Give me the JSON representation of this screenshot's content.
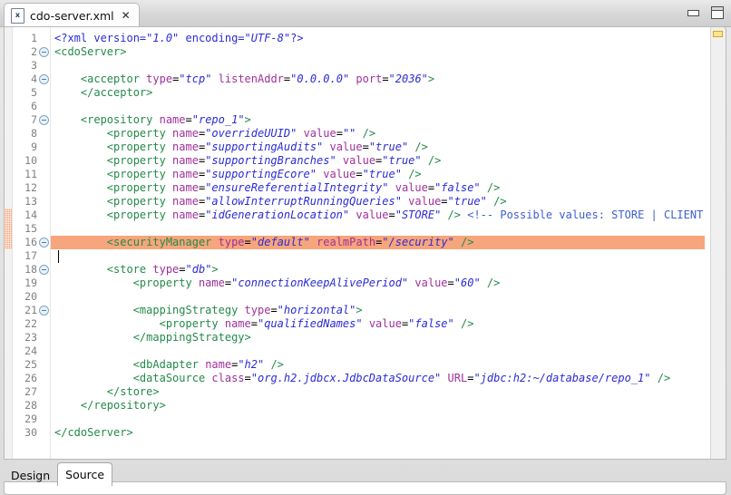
{
  "window": {
    "tab_title": "cdo-server.xml",
    "file_icon": "xml-file-icon",
    "close_icon": "✕",
    "minimize_label": "",
    "maximize_label": ""
  },
  "editor": {
    "highlighted_line": 16,
    "caret_line": 17,
    "change_bar_lines": [
      14,
      15,
      16
    ],
    "fold_lines": [
      2,
      4,
      7,
      16,
      18,
      21
    ],
    "overview_marker": "warning-marker",
    "colors": {
      "tag": "#248a49",
      "attribute": "#a0309a",
      "value": "#2b2bd4",
      "comment": "#3f5fd0",
      "highlight_row": "#f7a57c",
      "change_bar": "#f7a278",
      "warning_marker": "#ffe48a"
    },
    "lines": [
      {
        "n": 1,
        "fold": false,
        "chg": false,
        "hl": false,
        "tokens": [
          {
            "t": "decl",
            "s": "<?xml version="
          },
          {
            "t": "val",
            "s": "\"1.0\""
          },
          {
            "t": "decl",
            "s": " encoding="
          },
          {
            "t": "val",
            "s": "\"UTF-8\""
          },
          {
            "t": "decl",
            "s": "?>"
          }
        ]
      },
      {
        "n": 2,
        "fold": true,
        "chg": false,
        "hl": false,
        "tokens": [
          {
            "t": "tag",
            "s": "<cdoServer>"
          }
        ]
      },
      {
        "n": 3,
        "fold": false,
        "chg": false,
        "hl": false,
        "tokens": []
      },
      {
        "n": 4,
        "fold": true,
        "chg": false,
        "hl": false,
        "tokens": [
          {
            "t": "plain",
            "s": "    "
          },
          {
            "t": "tag",
            "s": "<acceptor "
          },
          {
            "t": "attr",
            "s": "type"
          },
          {
            "t": "eq",
            "s": "="
          },
          {
            "t": "val",
            "s": "\"tcp\""
          },
          {
            "t": "plain",
            "s": " "
          },
          {
            "t": "attr",
            "s": "listenAddr"
          },
          {
            "t": "eq",
            "s": "="
          },
          {
            "t": "val",
            "s": "\"0.0.0.0\""
          },
          {
            "t": "plain",
            "s": " "
          },
          {
            "t": "attr",
            "s": "port"
          },
          {
            "t": "eq",
            "s": "="
          },
          {
            "t": "val",
            "s": "\"2036\""
          },
          {
            "t": "tag",
            "s": ">"
          }
        ]
      },
      {
        "n": 5,
        "fold": false,
        "chg": false,
        "hl": false,
        "tokens": [
          {
            "t": "plain",
            "s": "    "
          },
          {
            "t": "tag",
            "s": "</acceptor>"
          }
        ]
      },
      {
        "n": 6,
        "fold": false,
        "chg": false,
        "hl": false,
        "tokens": []
      },
      {
        "n": 7,
        "fold": true,
        "chg": false,
        "hl": false,
        "tokens": [
          {
            "t": "plain",
            "s": "    "
          },
          {
            "t": "tag",
            "s": "<repository "
          },
          {
            "t": "attr",
            "s": "name"
          },
          {
            "t": "eq",
            "s": "="
          },
          {
            "t": "val",
            "s": "\"repo_1\""
          },
          {
            "t": "tag",
            "s": ">"
          }
        ]
      },
      {
        "n": 8,
        "fold": false,
        "chg": false,
        "hl": false,
        "tokens": [
          {
            "t": "plain",
            "s": "        "
          },
          {
            "t": "tag",
            "s": "<property "
          },
          {
            "t": "attr",
            "s": "name"
          },
          {
            "t": "eq",
            "s": "="
          },
          {
            "t": "val",
            "s": "\"overrideUUID\""
          },
          {
            "t": "plain",
            "s": " "
          },
          {
            "t": "attr",
            "s": "value"
          },
          {
            "t": "eq",
            "s": "="
          },
          {
            "t": "val",
            "s": "\"\""
          },
          {
            "t": "tag",
            "s": " />"
          }
        ]
      },
      {
        "n": 9,
        "fold": false,
        "chg": false,
        "hl": false,
        "tokens": [
          {
            "t": "plain",
            "s": "        "
          },
          {
            "t": "tag",
            "s": "<property "
          },
          {
            "t": "attr",
            "s": "name"
          },
          {
            "t": "eq",
            "s": "="
          },
          {
            "t": "val",
            "s": "\"supportingAudits\""
          },
          {
            "t": "plain",
            "s": " "
          },
          {
            "t": "attr",
            "s": "value"
          },
          {
            "t": "eq",
            "s": "="
          },
          {
            "t": "val",
            "s": "\"true\""
          },
          {
            "t": "tag",
            "s": " />"
          }
        ]
      },
      {
        "n": 10,
        "fold": false,
        "chg": false,
        "hl": false,
        "tokens": [
          {
            "t": "plain",
            "s": "        "
          },
          {
            "t": "tag",
            "s": "<property "
          },
          {
            "t": "attr",
            "s": "name"
          },
          {
            "t": "eq",
            "s": "="
          },
          {
            "t": "val",
            "s": "\"supportingBranches\""
          },
          {
            "t": "plain",
            "s": " "
          },
          {
            "t": "attr",
            "s": "value"
          },
          {
            "t": "eq",
            "s": "="
          },
          {
            "t": "val",
            "s": "\"true\""
          },
          {
            "t": "tag",
            "s": " />"
          }
        ]
      },
      {
        "n": 11,
        "fold": false,
        "chg": false,
        "hl": false,
        "tokens": [
          {
            "t": "plain",
            "s": "        "
          },
          {
            "t": "tag",
            "s": "<property "
          },
          {
            "t": "attr",
            "s": "name"
          },
          {
            "t": "eq",
            "s": "="
          },
          {
            "t": "val",
            "s": "\"supportingEcore\""
          },
          {
            "t": "plain",
            "s": " "
          },
          {
            "t": "attr",
            "s": "value"
          },
          {
            "t": "eq",
            "s": "="
          },
          {
            "t": "val",
            "s": "\"true\""
          },
          {
            "t": "tag",
            "s": " />"
          }
        ]
      },
      {
        "n": 12,
        "fold": false,
        "chg": false,
        "hl": false,
        "tokens": [
          {
            "t": "plain",
            "s": "        "
          },
          {
            "t": "tag",
            "s": "<property "
          },
          {
            "t": "attr",
            "s": "name"
          },
          {
            "t": "eq",
            "s": "="
          },
          {
            "t": "val",
            "s": "\"ensureReferentialIntegrity\""
          },
          {
            "t": "plain",
            "s": " "
          },
          {
            "t": "attr",
            "s": "value"
          },
          {
            "t": "eq",
            "s": "="
          },
          {
            "t": "val",
            "s": "\"false\""
          },
          {
            "t": "tag",
            "s": " />"
          }
        ]
      },
      {
        "n": 13,
        "fold": false,
        "chg": false,
        "hl": false,
        "tokens": [
          {
            "t": "plain",
            "s": "        "
          },
          {
            "t": "tag",
            "s": "<property "
          },
          {
            "t": "attr",
            "s": "name"
          },
          {
            "t": "eq",
            "s": "="
          },
          {
            "t": "val",
            "s": "\"allowInterruptRunningQueries\""
          },
          {
            "t": "plain",
            "s": " "
          },
          {
            "t": "attr",
            "s": "value"
          },
          {
            "t": "eq",
            "s": "="
          },
          {
            "t": "val",
            "s": "\"true\""
          },
          {
            "t": "tag",
            "s": " />"
          }
        ]
      },
      {
        "n": 14,
        "fold": false,
        "chg": true,
        "hl": false,
        "tokens": [
          {
            "t": "plain",
            "s": "        "
          },
          {
            "t": "tag",
            "s": "<property "
          },
          {
            "t": "attr",
            "s": "name"
          },
          {
            "t": "eq",
            "s": "="
          },
          {
            "t": "val",
            "s": "\"idGenerationLocation\""
          },
          {
            "t": "plain",
            "s": " "
          },
          {
            "t": "attr",
            "s": "value"
          },
          {
            "t": "eq",
            "s": "="
          },
          {
            "t": "val",
            "s": "\"STORE\""
          },
          {
            "t": "tag",
            "s": " />"
          },
          {
            "t": "plain",
            "s": " "
          },
          {
            "t": "cmt",
            "s": "<!-- Possible values: STORE | CLIENT -->"
          }
        ]
      },
      {
        "n": 15,
        "fold": false,
        "chg": true,
        "hl": false,
        "tokens": []
      },
      {
        "n": 16,
        "fold": true,
        "chg": true,
        "hl": true,
        "tokens": [
          {
            "t": "plain",
            "s": "        "
          },
          {
            "t": "tag",
            "s": "<securityManager "
          },
          {
            "t": "attr",
            "s": "type"
          },
          {
            "t": "eq",
            "s": "="
          },
          {
            "t": "val",
            "s": "\"default\""
          },
          {
            "t": "plain",
            "s": " "
          },
          {
            "t": "attr",
            "s": "realmPath"
          },
          {
            "t": "eq",
            "s": "="
          },
          {
            "t": "val",
            "s": "\"/security\""
          },
          {
            "t": "tag",
            "s": " />"
          }
        ]
      },
      {
        "n": 17,
        "fold": false,
        "chg": false,
        "hl": false,
        "caret": true,
        "tokens": []
      },
      {
        "n": 18,
        "fold": true,
        "chg": false,
        "hl": false,
        "tokens": [
          {
            "t": "plain",
            "s": "        "
          },
          {
            "t": "tag",
            "s": "<store "
          },
          {
            "t": "attr",
            "s": "type"
          },
          {
            "t": "eq",
            "s": "="
          },
          {
            "t": "val",
            "s": "\"db\""
          },
          {
            "t": "tag",
            "s": ">"
          }
        ]
      },
      {
        "n": 19,
        "fold": false,
        "chg": false,
        "hl": false,
        "tokens": [
          {
            "t": "plain",
            "s": "            "
          },
          {
            "t": "tag",
            "s": "<property "
          },
          {
            "t": "attr",
            "s": "name"
          },
          {
            "t": "eq",
            "s": "="
          },
          {
            "t": "val",
            "s": "\"connectionKeepAlivePeriod\""
          },
          {
            "t": "plain",
            "s": " "
          },
          {
            "t": "attr",
            "s": "value"
          },
          {
            "t": "eq",
            "s": "="
          },
          {
            "t": "val",
            "s": "\"60\""
          },
          {
            "t": "tag",
            "s": " />"
          }
        ]
      },
      {
        "n": 20,
        "fold": false,
        "chg": false,
        "hl": false,
        "tokens": []
      },
      {
        "n": 21,
        "fold": true,
        "chg": false,
        "hl": false,
        "tokens": [
          {
            "t": "plain",
            "s": "            "
          },
          {
            "t": "tag",
            "s": "<mappingStrategy "
          },
          {
            "t": "attr",
            "s": "type"
          },
          {
            "t": "eq",
            "s": "="
          },
          {
            "t": "val",
            "s": "\"horizontal\""
          },
          {
            "t": "tag",
            "s": ">"
          }
        ]
      },
      {
        "n": 22,
        "fold": false,
        "chg": false,
        "hl": false,
        "tokens": [
          {
            "t": "plain",
            "s": "                "
          },
          {
            "t": "tag",
            "s": "<property "
          },
          {
            "t": "attr",
            "s": "name"
          },
          {
            "t": "eq",
            "s": "="
          },
          {
            "t": "val",
            "s": "\"qualifiedNames\""
          },
          {
            "t": "plain",
            "s": " "
          },
          {
            "t": "attr",
            "s": "value"
          },
          {
            "t": "eq",
            "s": "="
          },
          {
            "t": "val",
            "s": "\"false\""
          },
          {
            "t": "tag",
            "s": " />"
          }
        ]
      },
      {
        "n": 23,
        "fold": false,
        "chg": false,
        "hl": false,
        "tokens": [
          {
            "t": "plain",
            "s": "            "
          },
          {
            "t": "tag",
            "s": "</mappingStrategy>"
          }
        ]
      },
      {
        "n": 24,
        "fold": false,
        "chg": false,
        "hl": false,
        "tokens": []
      },
      {
        "n": 25,
        "fold": false,
        "chg": false,
        "hl": false,
        "tokens": [
          {
            "t": "plain",
            "s": "            "
          },
          {
            "t": "tag",
            "s": "<dbAdapter "
          },
          {
            "t": "attr",
            "s": "name"
          },
          {
            "t": "eq",
            "s": "="
          },
          {
            "t": "val",
            "s": "\"h2\""
          },
          {
            "t": "tag",
            "s": " />"
          }
        ]
      },
      {
        "n": 26,
        "fold": false,
        "chg": false,
        "hl": false,
        "tokens": [
          {
            "t": "plain",
            "s": "            "
          },
          {
            "t": "tag",
            "s": "<dataSource "
          },
          {
            "t": "attr",
            "s": "class"
          },
          {
            "t": "eq",
            "s": "="
          },
          {
            "t": "val",
            "s": "\"org.h2.jdbcx.JdbcDataSource\""
          },
          {
            "t": "plain",
            "s": " "
          },
          {
            "t": "attr",
            "s": "URL"
          },
          {
            "t": "eq",
            "s": "="
          },
          {
            "t": "val",
            "s": "\"jdbc:h2:~/database/repo_1\""
          },
          {
            "t": "tag",
            "s": " />"
          }
        ]
      },
      {
        "n": 27,
        "fold": false,
        "chg": false,
        "hl": false,
        "tokens": [
          {
            "t": "plain",
            "s": "        "
          },
          {
            "t": "tag",
            "s": "</store>"
          }
        ]
      },
      {
        "n": 28,
        "fold": false,
        "chg": false,
        "hl": false,
        "tokens": [
          {
            "t": "plain",
            "s": "    "
          },
          {
            "t": "tag",
            "s": "</repository>"
          }
        ]
      },
      {
        "n": 29,
        "fold": false,
        "chg": false,
        "hl": false,
        "tokens": []
      },
      {
        "n": 30,
        "fold": false,
        "chg": false,
        "hl": false,
        "tokens": [
          {
            "t": "tag",
            "s": "</cdoServer>"
          }
        ]
      }
    ]
  },
  "bottom_tabs": [
    {
      "label": "Design",
      "selected": false
    },
    {
      "label": "Source",
      "selected": true
    }
  ]
}
